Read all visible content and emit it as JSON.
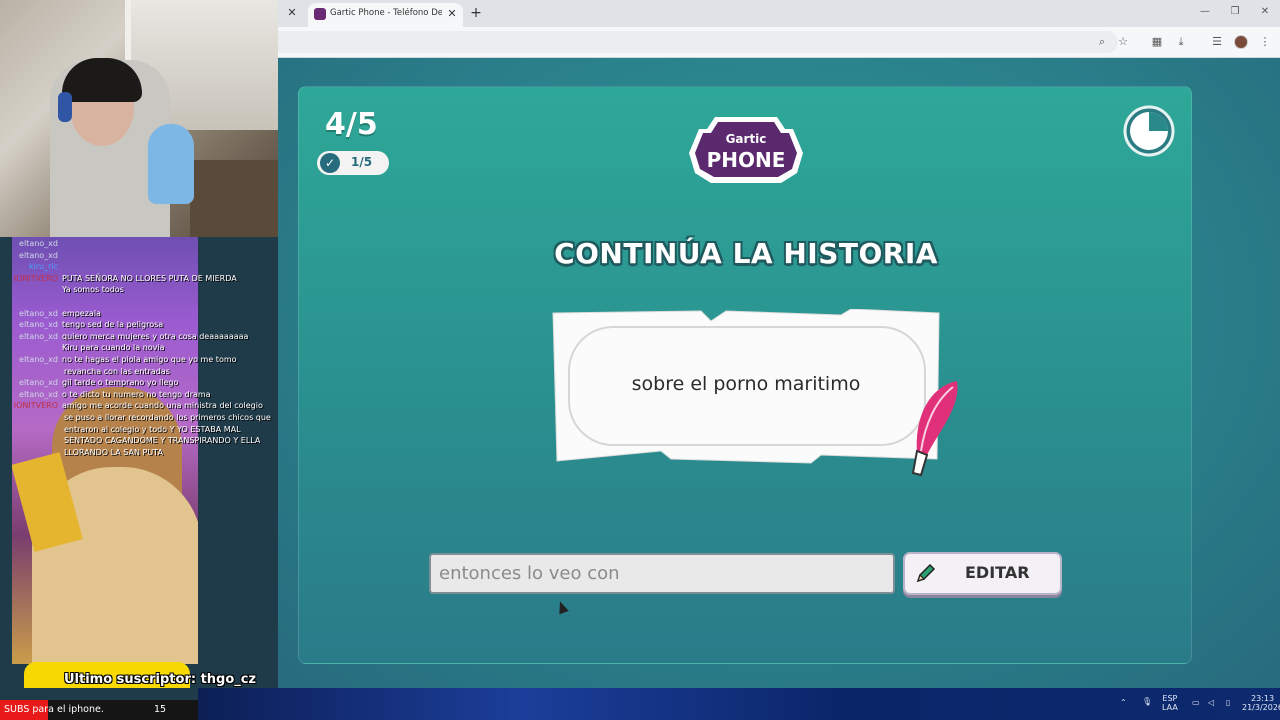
{
  "browser": {
    "tab_title": "Gartic Phone - Teléfono Descono",
    "icons": [
      "close-icon",
      "plus-icon",
      "zoom-icon",
      "star-icon",
      "translate-icon",
      "download-icon",
      "reading-list-icon",
      "avatar",
      "menu-icon"
    ]
  },
  "game": {
    "round": "4/5",
    "players_done": "1/5",
    "logo_top": "Gartic",
    "logo_main": "PHONE",
    "heading": "CONTINÚA LA HISTORIA",
    "prompt": "sobre el porno maritimo",
    "answer_value": "entonces lo veo con",
    "edit_label": "EDITAR",
    "timer_remaining_fraction": 0.75,
    "colors": {
      "accent": "#2a9a93",
      "brand": "#5b2a6e"
    }
  },
  "stream": {
    "chat": [
      {
        "user": "eltano_xd",
        "msg": "",
        "cont": ""
      },
      {
        "user": "eltano_xd",
        "msg": "",
        "cont": ""
      },
      {
        "user": "kiru_rlc",
        "msg": "",
        "cont": ""
      },
      {
        "user": "IONITVERO",
        "msg": "PUTA SEÑORA NO LLORES PUTA DE MIERDA",
        "cont": ""
      },
      {
        "user": "",
        "msg": "Ya somos todos",
        "cont": ""
      },
      {
        "user": "",
        "msg": "",
        "cont": ""
      },
      {
        "user": "eltano_xd",
        "msg": "empezala",
        "cont": ""
      },
      {
        "user": "eltano_xd",
        "msg": "tengo sed de la peligrosa",
        "cont": ""
      },
      {
        "user": "eltano_xd",
        "msg": "quiero merca mujeres y otra cosa deaaaaaaaa",
        "cont": ""
      },
      {
        "user": "",
        "msg": "Kiru para cuando la novia",
        "cont": ""
      },
      {
        "user": "eltano_xd",
        "msg": "no te hagas el piola amigo que yo me tomo",
        "cont": "revancha con las entradas"
      },
      {
        "user": "eltano_xd",
        "msg": "gil tarde o temprano yo llego",
        "cont": ""
      },
      {
        "user": "eltano_xd",
        "msg": "o te dicto tu numero no tengo drama",
        "cont": ""
      },
      {
        "user": "IONITVERO",
        "msg": "amigo me acorde cuando una ministra del colegio",
        "cont": "se puso a llorar recordando los primeros chicos que entraron al colegio y todo Y YO ESTABA MAL SENTADO CAGANDOME Y TRANSPIRANDO Y ELLA LLORANDO LA SAN PUTA"
      }
    ],
    "latest_sub_label": "Ultimo suscriptor: thgo_cz",
    "goal_label": "SUBS para el iphone.",
    "goal_current": "15",
    "goal_max": "100",
    "goal_fraction": 0.15
  },
  "taskbar": {
    "lang_top": "ESP",
    "lang_bottom": "LAA",
    "time": "23:13",
    "date": "21/3/2026"
  }
}
